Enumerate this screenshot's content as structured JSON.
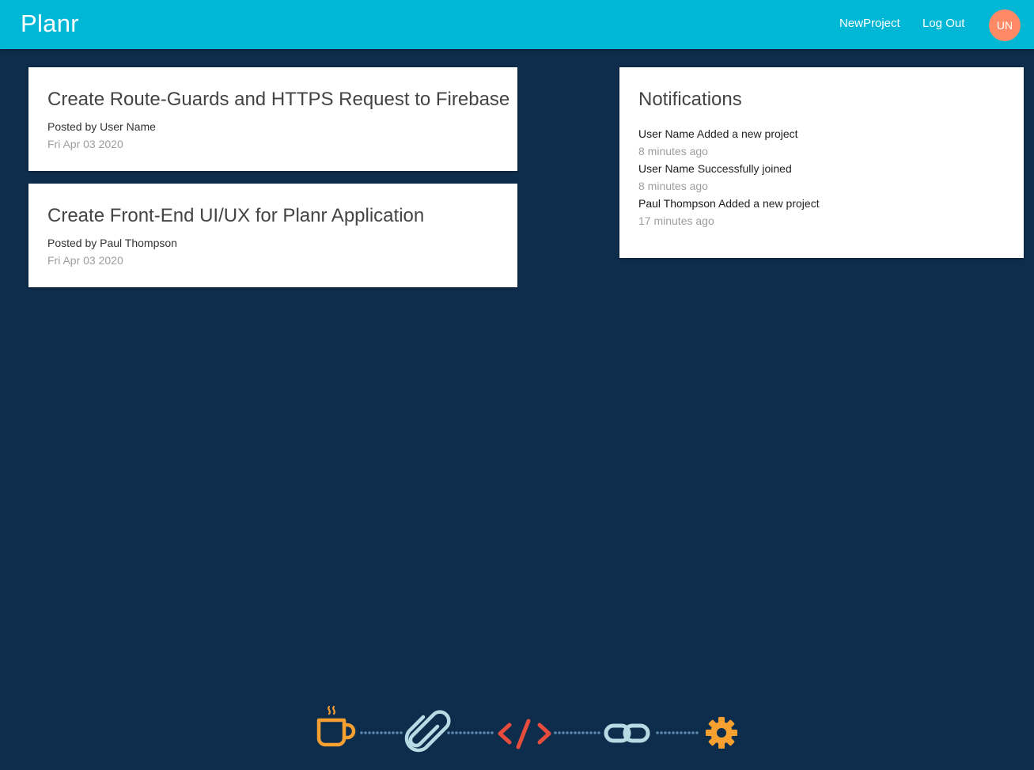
{
  "navbar": {
    "brand": "Planr",
    "links": {
      "new_project": "NewProject",
      "log_out": "Log Out"
    },
    "avatar_initials": "UN"
  },
  "projects": [
    {
      "title": "Create Route-Guards and HTTPS Request to Firebase",
      "posted_by": "Posted by User Name",
      "date": "Fri Apr 03 2020"
    },
    {
      "title": "Create Front-End UI/UX for Planr Application",
      "posted_by": "Posted by Paul Thompson",
      "date": "Fri Apr 03 2020"
    }
  ],
  "notifications": {
    "title": "Notifications",
    "items": [
      {
        "user": "User Name",
        "action": "Added a new project",
        "time": "8 minutes ago"
      },
      {
        "user": "User Name",
        "action": "Successfully joined",
        "time": "8 minutes ago"
      },
      {
        "user": "Paul Thompson",
        "action": "Added a new project",
        "time": "17 minutes ago"
      }
    ]
  },
  "footer": {
    "icons": [
      "coffee-cup-icon",
      "paperclip-icon",
      "code-icon",
      "chain-link-icon",
      "gear-icon"
    ]
  },
  "colors": {
    "navbar": "#00b7d6",
    "background": "#0e2c4b",
    "avatar": "#ff8a65",
    "card": "#ffffff",
    "muted_text": "#9e9e9e",
    "icon_orange": "#f5a031",
    "icon_light_blue": "#b6dbe5",
    "icon_red": "#e74c3c",
    "dots": "#5d86ad"
  }
}
